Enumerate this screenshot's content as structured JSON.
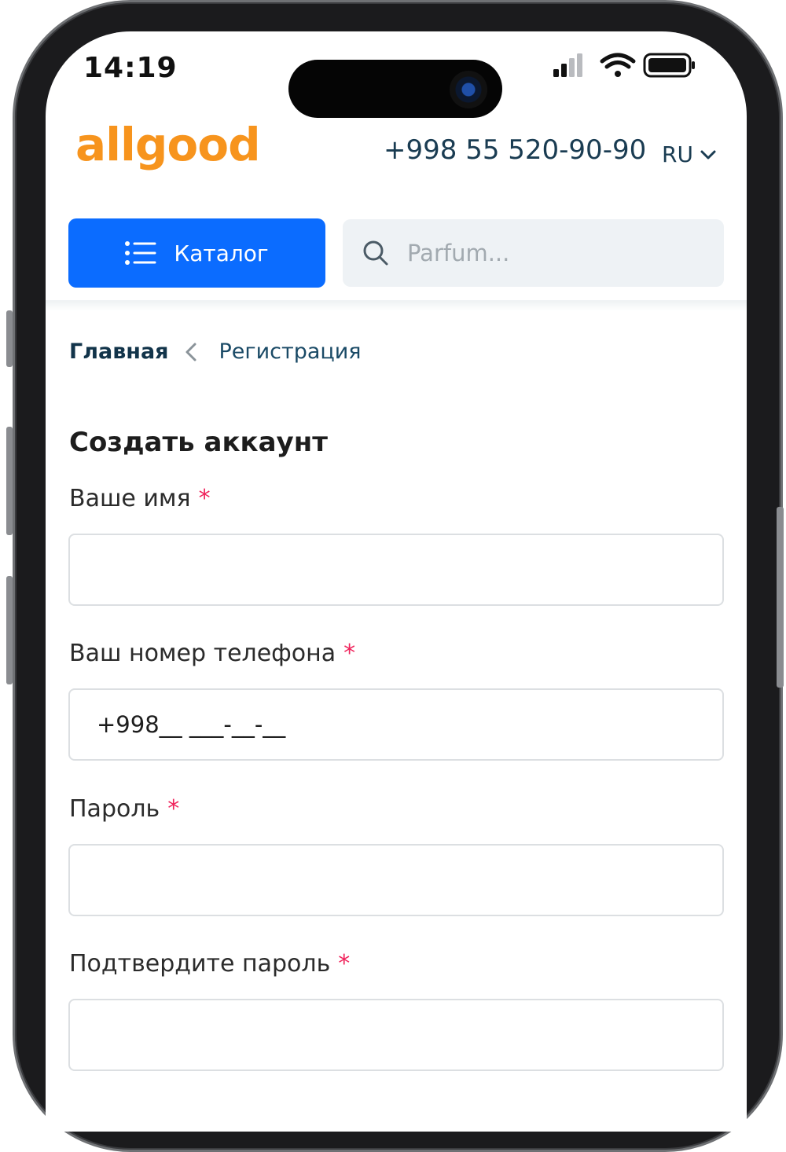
{
  "status_bar": {
    "time": "14:19"
  },
  "header": {
    "logo_text": "allgood",
    "phone": "+998 55 520-90-90",
    "language": "RU",
    "catalog_label": "Каталог",
    "search_placeholder": "Parfum..."
  },
  "breadcrumb": {
    "home": "Главная",
    "current": "Регистрация"
  },
  "form": {
    "title": "Создать аккаунт",
    "required_mark": "*",
    "fields": [
      {
        "label": "Ваше имя",
        "value": ""
      },
      {
        "label": "Ваш номер телефона",
        "value": "+998__ ___-__-__"
      },
      {
        "label": "Пароль",
        "value": ""
      },
      {
        "label": "Подтвердите пароль",
        "value": ""
      }
    ]
  },
  "colors": {
    "brand_orange": "#f7941d",
    "primary_blue": "#0b6cff",
    "required_red": "#f0245c",
    "text_navy": "#1a3c52"
  },
  "icons": [
    "signal-icon",
    "wifi-icon",
    "battery-icon",
    "chevron-down-icon",
    "list-icon",
    "search-icon",
    "chevron-left-icon"
  ]
}
